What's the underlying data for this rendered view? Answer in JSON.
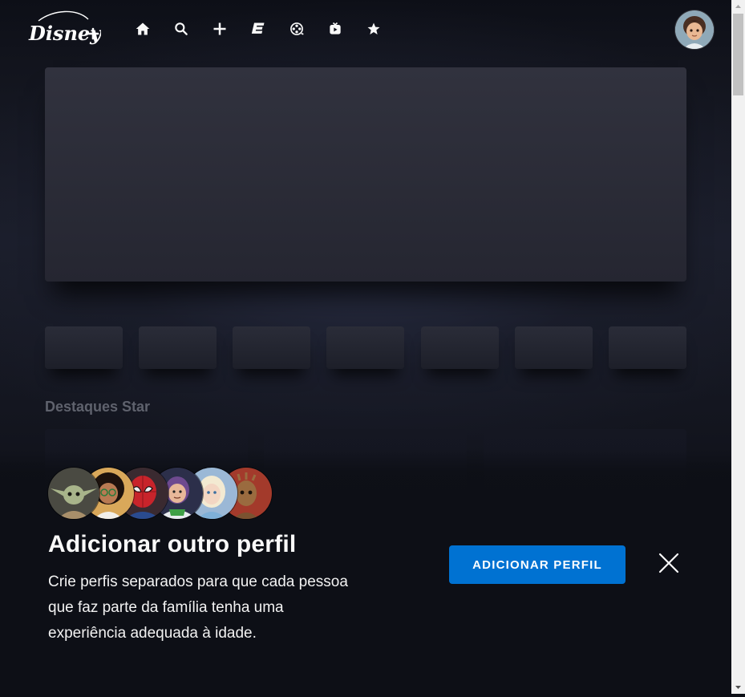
{
  "header": {
    "logo_alt": "Disney+",
    "nav": [
      {
        "name": "nav-home",
        "icon": "home-icon"
      },
      {
        "name": "nav-search",
        "icon": "search-icon"
      },
      {
        "name": "nav-watchlist",
        "icon": "plus-icon"
      },
      {
        "name": "nav-originals",
        "icon": "originals-icon"
      },
      {
        "name": "nav-movies",
        "icon": "film-reel-icon"
      },
      {
        "name": "nav-series",
        "icon": "tv-icon"
      },
      {
        "name": "nav-star",
        "icon": "star-icon"
      }
    ],
    "profile_avatar": "profile-avatar"
  },
  "main": {
    "section_title": "Destaques Star"
  },
  "promo": {
    "characters": [
      "grogu",
      "mirabel",
      "spider-man",
      "buzz-lightyear",
      "elsa",
      "groot"
    ],
    "title": "Adicionar outro perfil",
    "text": "Crie perfis separados para que cada pessoa que faz parte da família tenha uma experiência adequada à idade.",
    "button_label": "ADICIONAR PERFIL",
    "close_icon": "close-icon"
  },
  "colors": {
    "accent": "#0072d2",
    "background": "#0c0e15",
    "text": "#f9f9f9"
  }
}
